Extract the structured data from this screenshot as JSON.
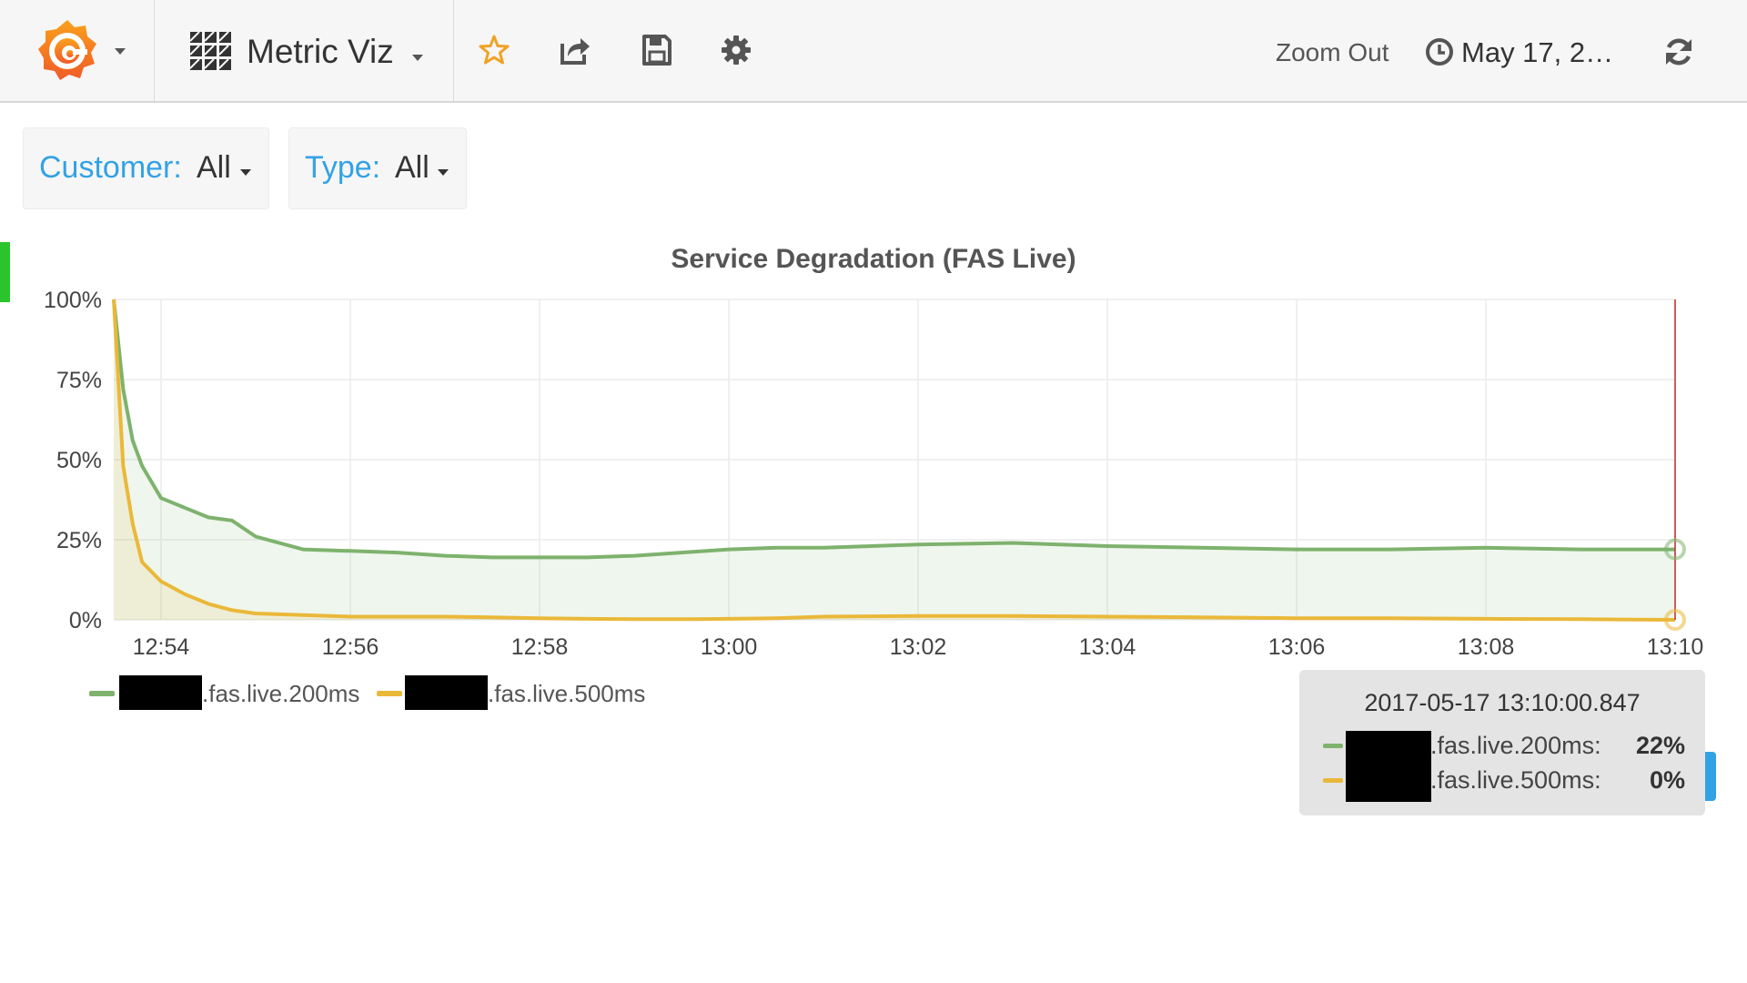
{
  "navbar": {
    "dashboard_title": "Metric Viz",
    "zoom_out_label": "Zoom Out",
    "time_range": "May 17, 2…",
    "icons": [
      "grafana-logo-icon",
      "dashboard-grid-icon",
      "star-icon",
      "share-icon",
      "save-icon",
      "settings-gear-icon",
      "clock-icon",
      "refresh-icon"
    ]
  },
  "variables": [
    {
      "label": "Customer:",
      "value": "All"
    },
    {
      "label": "Type:",
      "value": "All"
    }
  ],
  "panel": {
    "title": "Service Degradation (FAS Live)"
  },
  "colors": {
    "accent_blue": "#33a2e5",
    "series_200ms": "#7eb26d",
    "series_500ms": "#eab839",
    "crosshair": "#c22a2a",
    "row_marker": "#2cc42c"
  },
  "chart_data": {
    "type": "area",
    "title": "Service Degradation (FAS Live)",
    "y_ticks": [
      "100%",
      "75%",
      "50%",
      "25%",
      "0%"
    ],
    "ylim": [
      0,
      100
    ],
    "x_ticks": [
      "12:54",
      "12:56",
      "12:58",
      "13:00",
      "13:02",
      "13:04",
      "13:06",
      "13:08",
      "13:10"
    ],
    "grid": true,
    "legend_position": "bottom-left",
    "x": [
      "12:53.5",
      "12:53.6",
      "12:53.7",
      "12:53.8",
      "12:54",
      "12:54.25",
      "12:54.5",
      "12:54.75",
      "12:55",
      "12:55.5",
      "12:56",
      "12:56.5",
      "12:57",
      "12:57.5",
      "12:58",
      "12:58.5",
      "12:59",
      "12:59.5",
      "13:00",
      "13:00.5",
      "13:01",
      "13:02",
      "13:03",
      "13:04",
      "13:05",
      "13:06",
      "13:07",
      "13:08",
      "13:09",
      "13:10"
    ],
    "series": [
      {
        "name": ".fas.live.200ms",
        "values": [
          100,
          72,
          56,
          48,
          38,
          35,
          32,
          31,
          26,
          22,
          21.5,
          21,
          20,
          19.5,
          19.5,
          19.5,
          20,
          21,
          22,
          22.5,
          22.5,
          23.5,
          24,
          23,
          22.5,
          22,
          22,
          22.5,
          22,
          22
        ]
      },
      {
        "name": ".fas.live.500ms",
        "values": [
          100,
          48,
          30,
          18,
          12,
          8,
          5,
          3,
          2,
          1.5,
          1,
          1,
          1,
          0.8,
          0.5,
          0.3,
          0.2,
          0.2,
          0.3,
          0.5,
          1,
          1.2,
          1.2,
          1,
          0.8,
          0.5,
          0.5,
          0.3,
          0.2,
          0
        ]
      }
    ]
  },
  "tooltip": {
    "time": "2017-05-17 13:10:00.847",
    "rows": [
      {
        "name": ".fas.live.200ms:",
        "value": "22%"
      },
      {
        "name": ".fas.live.500ms:",
        "value": "0%"
      }
    ]
  }
}
